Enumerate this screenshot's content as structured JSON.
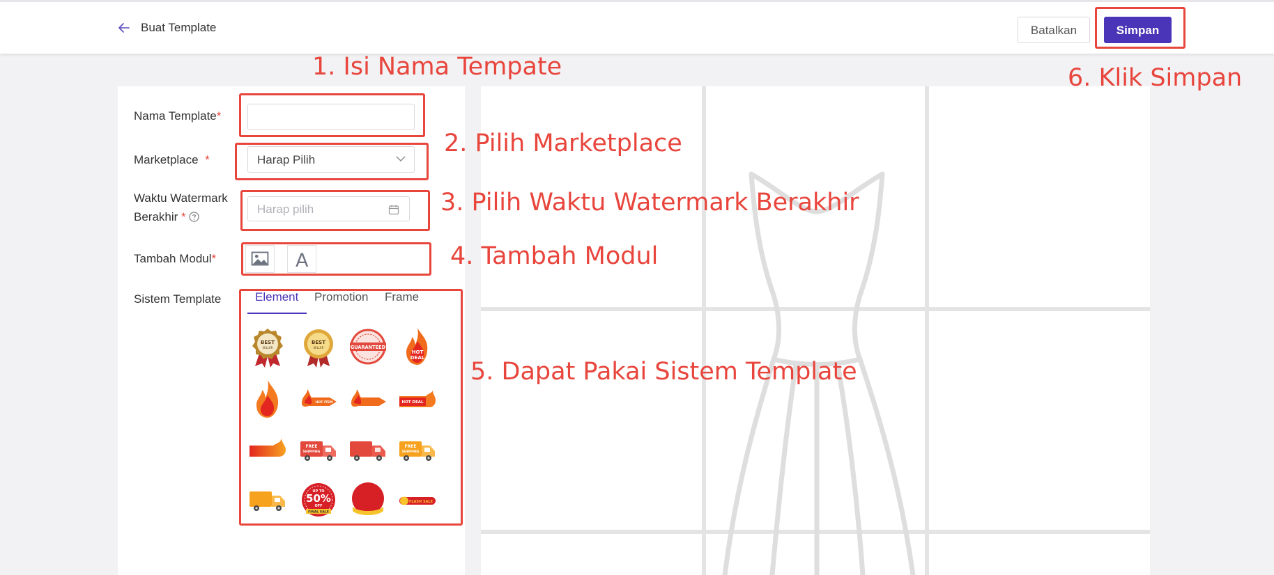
{
  "header": {
    "title": "Buat Template",
    "cancel_label": "Batalkan",
    "save_label": "Simpan"
  },
  "form": {
    "template_name": {
      "label": "Nama Template",
      "required_mark": "*",
      "value": ""
    },
    "marketplace": {
      "label": "Marketplace",
      "required_mark": "*",
      "selected": "Harap Pilih"
    },
    "expiry": {
      "label_line1": "Waktu Watermark",
      "label_line2": "Berakhir",
      "required_mark": "*",
      "placeholder": "Harap pilih"
    },
    "module": {
      "label": "Tambah Modul",
      "required_mark": "*",
      "text_glyph": "A"
    },
    "system_template": {
      "label": "Sistem Template",
      "tabs": [
        {
          "label": "Element",
          "active": true
        },
        {
          "label": "Promotion",
          "active": false
        },
        {
          "label": "Frame",
          "active": false
        }
      ]
    }
  },
  "stickers": [
    {
      "name": "best-seller-badge-icon",
      "text_1": "BEST",
      "text_2": "SELLER"
    },
    {
      "name": "best-seller-gold-badge-icon",
      "text_1": "BEST",
      "text_2": "SELLER"
    },
    {
      "name": "guaranteed-stamp-icon",
      "text_1": "GUARANTEED"
    },
    {
      "name": "hot-deal-flame-icon",
      "text_1": "HOT",
      "text_2": "DEAL"
    },
    {
      "name": "flame-icon"
    },
    {
      "name": "hot-item-flame-arrow-icon",
      "text_1": "HOT ITEM"
    },
    {
      "name": "flame-arrow-icon"
    },
    {
      "name": "hot-deal-banner-icon",
      "text_1": "HOT DEAL"
    },
    {
      "name": "fire-banner-icon"
    },
    {
      "name": "free-shipping-truck-icon",
      "text_1": "FREE",
      "text_2": "SHIPPING"
    },
    {
      "name": "delivery-truck-icon"
    },
    {
      "name": "free-shipping-orange-truck-icon",
      "text_1": "FREE",
      "text_2": "SHIPPING"
    },
    {
      "name": "orange-truck-icon"
    },
    {
      "name": "up-to-50-off-badge-icon",
      "text_1": "UP TO",
      "text_2": "50%",
      "text_3": "OFF",
      "text_4": "FINAL SALE"
    },
    {
      "name": "red-circle-ribbon-icon"
    },
    {
      "name": "flash-sale-banner-icon",
      "text_1": "FLASH SALE"
    }
  ],
  "annotations": [
    "1. Isi Nama Tempate",
    "2. Pilih Marketplace",
    "3. Pilih Waktu Watermark Berakhir",
    "4. Tambah Modul",
    "5. Dapat Pakai Sistem Template",
    "6. Klik Simpan"
  ],
  "colors": {
    "accent": "#4a35b8",
    "annotation": "#e8453c",
    "background": "#f2f2f4",
    "required": "#e8453c"
  }
}
